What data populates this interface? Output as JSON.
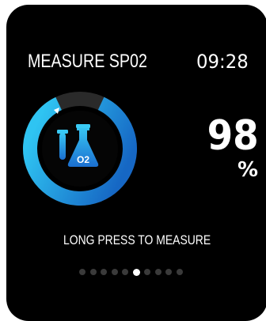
{
  "header": {
    "title": "MEASURE SP02",
    "time": "09:28"
  },
  "reading": {
    "value": "98",
    "unit": "%"
  },
  "icon": {
    "name": "flask-o2-icon",
    "label": "O2"
  },
  "hint": "LONG PRESS TO MEASURE",
  "pager": {
    "count": 10,
    "active_index": 5
  },
  "colors": {
    "background": "#000000",
    "ring_light": "#2ec0f0",
    "ring_dark": "#1570c8",
    "ring_track": "#2a2a2a",
    "text": "#ffffff"
  }
}
